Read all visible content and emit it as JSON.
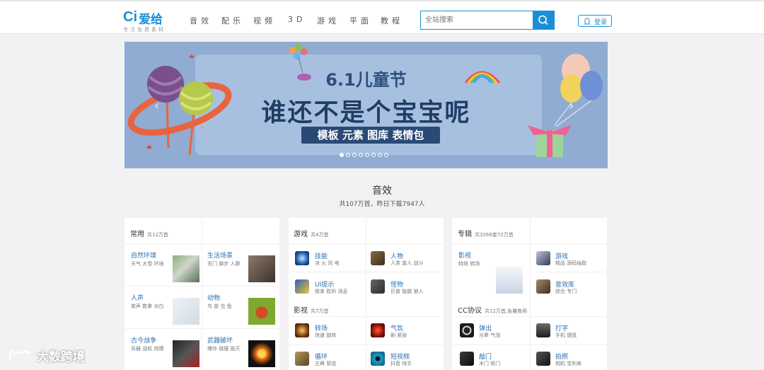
{
  "logo": {
    "mark": "Ci",
    "name": "爱给",
    "slogan": "专注免费素材"
  },
  "nav": [
    "音效",
    "配乐",
    "视频",
    "3D",
    "游戏",
    "平面",
    "教程"
  ],
  "search": {
    "placeholder": "全站搜索"
  },
  "login": {
    "label": "登录"
  },
  "banner": {
    "line1": "6.1儿童节",
    "line2": "谁还不是个宝宝呢",
    "line3": "模板 元素 图库 表情包",
    "prev": "‹",
    "next": "›",
    "slide_count": 8,
    "active_slide": 1
  },
  "section": {
    "title": "音效",
    "subtitle": "共107万首，昨日下载7947人"
  },
  "cards": [
    {
      "title": "常用",
      "count": "共12万首",
      "items": [
        {
          "title": "自然环境",
          "tags": "天气 大雪 环境"
        },
        {
          "title": "生活场景",
          "tags": "关门 脚步 人群"
        },
        {
          "title": "人声",
          "tags": "笑声 数拿 对白"
        },
        {
          "title": "动物",
          "tags": "鸟 兽 虫 鱼"
        },
        {
          "title": "古今战争",
          "tags": "兵器 战机 肉搏"
        },
        {
          "title": "武器破坏",
          "tags": "爆炸 碰撞 毁灭"
        }
      ]
    },
    {
      "title": "游戏",
      "count": "共4万首",
      "items": [
        {
          "title": "技能",
          "tags": "冰 火 风 电"
        },
        {
          "title": "人物",
          "tags": "人类 兽人 战斗"
        },
        {
          "title": "UI提示",
          "tags": "按单 胜利 消息"
        },
        {
          "title": "怪物",
          "tags": "巨兽 骷髅 狼人"
        }
      ],
      "sub": {
        "title": "影视",
        "count": "共7万首",
        "items": [
          {
            "title": "转场",
            "tags": "快速 旋转"
          },
          {
            "title": "气氛",
            "tags": "剧 紧张"
          },
          {
            "title": "循环",
            "tags": "古典 管弦"
          },
          {
            "title": "短视频",
            "tags": "抖音 快手"
          }
        ]
      }
    },
    {
      "title": "专辑",
      "count": "共3268套72万首",
      "items": [
        {
          "title": "影视",
          "tags": "特效 转场"
        },
        {
          "title": "游戏",
          "tags": "精品 源码抽取"
        },
        {
          "title": "音效库",
          "tags": "综合 专门"
        }
      ],
      "sub": {
        "title": "CC协议",
        "count": "共12万首,免署商用",
        "items": [
          {
            "title": "弹出",
            "tags": "光晕 气泡"
          },
          {
            "title": "打字",
            "tags": "手机 键盘"
          },
          {
            "title": "敲门",
            "tags": "木门 铁门"
          },
          {
            "title": "拍照",
            "tags": "相机 宝利来"
          }
        ]
      }
    }
  ],
  "watermark": "大数跨境",
  "colors": {
    "brand": "#1a8fd8",
    "link": "#2a6fb0",
    "background": "#f2f2f4"
  }
}
